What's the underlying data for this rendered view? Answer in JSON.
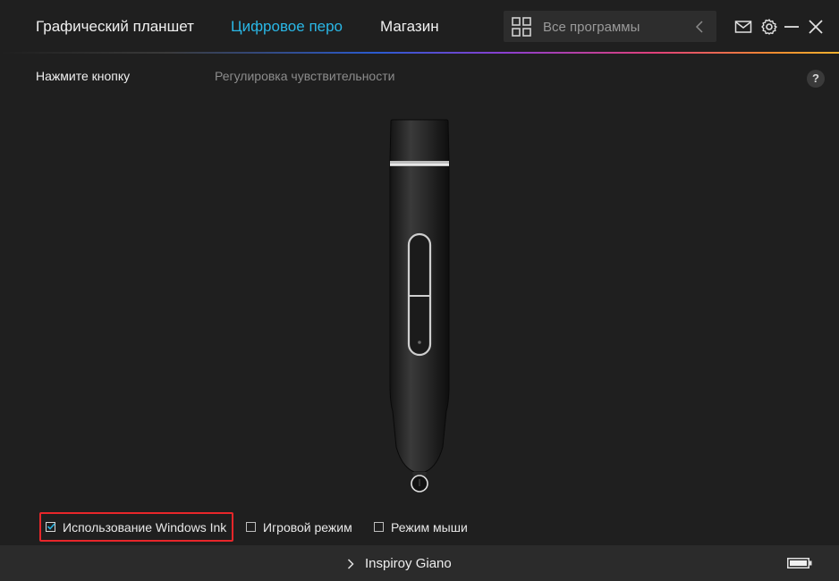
{
  "header": {
    "tabs": [
      {
        "label": "Графический планшет",
        "active": false
      },
      {
        "label": "Цифровое перо",
        "active": true
      },
      {
        "label": "Магазин",
        "active": false
      }
    ],
    "search": {
      "placeholder": "Все программы",
      "value": ""
    },
    "icons": [
      "apps-grid-icon",
      "chevron-left-icon",
      "mail-icon",
      "gear-icon",
      "minimize-icon",
      "close-icon"
    ]
  },
  "subtabs": [
    {
      "label": "Нажмите кнопку",
      "active": true
    },
    {
      "label": "Регулировка чувствительности",
      "active": false
    }
  ],
  "help_label": "?",
  "options": [
    {
      "label": "Использование Windows Ink",
      "checked": true
    },
    {
      "label": "Игровой режим",
      "checked": false
    },
    {
      "label": "Режим мыши",
      "checked": false
    }
  ],
  "status": {
    "device_name": "Inspiroy Giano"
  },
  "colors": {
    "accent": "#2ab7e6",
    "highlight": "#e8262a",
    "background": "#1f1f1f"
  }
}
